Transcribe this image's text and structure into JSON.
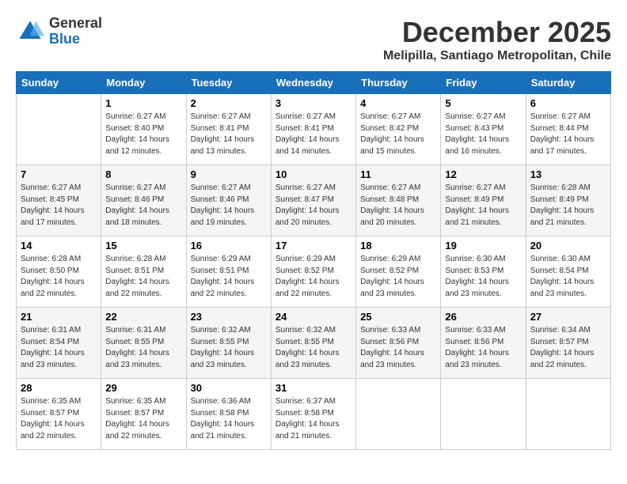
{
  "logo": {
    "line1": "General",
    "line2": "Blue"
  },
  "title": "December 2025",
  "location": "Melipilla, Santiago Metropolitan, Chile",
  "weekdays": [
    "Sunday",
    "Monday",
    "Tuesday",
    "Wednesday",
    "Thursday",
    "Friday",
    "Saturday"
  ],
  "weeks": [
    [
      {
        "day": "",
        "info": ""
      },
      {
        "day": "1",
        "info": "Sunrise: 6:27 AM\nSunset: 8:40 PM\nDaylight: 14 hours\nand 12 minutes."
      },
      {
        "day": "2",
        "info": "Sunrise: 6:27 AM\nSunset: 8:41 PM\nDaylight: 14 hours\nand 13 minutes."
      },
      {
        "day": "3",
        "info": "Sunrise: 6:27 AM\nSunset: 8:41 PM\nDaylight: 14 hours\nand 14 minutes."
      },
      {
        "day": "4",
        "info": "Sunrise: 6:27 AM\nSunset: 8:42 PM\nDaylight: 14 hours\nand 15 minutes."
      },
      {
        "day": "5",
        "info": "Sunrise: 6:27 AM\nSunset: 8:43 PM\nDaylight: 14 hours\nand 16 minutes."
      },
      {
        "day": "6",
        "info": "Sunrise: 6:27 AM\nSunset: 8:44 PM\nDaylight: 14 hours\nand 17 minutes."
      }
    ],
    [
      {
        "day": "7",
        "info": "Sunrise: 6:27 AM\nSunset: 8:45 PM\nDaylight: 14 hours\nand 17 minutes."
      },
      {
        "day": "8",
        "info": "Sunrise: 6:27 AM\nSunset: 8:46 PM\nDaylight: 14 hours\nand 18 minutes."
      },
      {
        "day": "9",
        "info": "Sunrise: 6:27 AM\nSunset: 8:46 PM\nDaylight: 14 hours\nand 19 minutes."
      },
      {
        "day": "10",
        "info": "Sunrise: 6:27 AM\nSunset: 8:47 PM\nDaylight: 14 hours\nand 20 minutes."
      },
      {
        "day": "11",
        "info": "Sunrise: 6:27 AM\nSunset: 8:48 PM\nDaylight: 14 hours\nand 20 minutes."
      },
      {
        "day": "12",
        "info": "Sunrise: 6:27 AM\nSunset: 8:49 PM\nDaylight: 14 hours\nand 21 minutes."
      },
      {
        "day": "13",
        "info": "Sunrise: 6:28 AM\nSunset: 8:49 PM\nDaylight: 14 hours\nand 21 minutes."
      }
    ],
    [
      {
        "day": "14",
        "info": "Sunrise: 6:28 AM\nSunset: 8:50 PM\nDaylight: 14 hours\nand 22 minutes."
      },
      {
        "day": "15",
        "info": "Sunrise: 6:28 AM\nSunset: 8:51 PM\nDaylight: 14 hours\nand 22 minutes."
      },
      {
        "day": "16",
        "info": "Sunrise: 6:29 AM\nSunset: 8:51 PM\nDaylight: 14 hours\nand 22 minutes."
      },
      {
        "day": "17",
        "info": "Sunrise: 6:29 AM\nSunset: 8:52 PM\nDaylight: 14 hours\nand 22 minutes."
      },
      {
        "day": "18",
        "info": "Sunrise: 6:29 AM\nSunset: 8:52 PM\nDaylight: 14 hours\nand 23 minutes."
      },
      {
        "day": "19",
        "info": "Sunrise: 6:30 AM\nSunset: 8:53 PM\nDaylight: 14 hours\nand 23 minutes."
      },
      {
        "day": "20",
        "info": "Sunrise: 6:30 AM\nSunset: 8:54 PM\nDaylight: 14 hours\nand 23 minutes."
      }
    ],
    [
      {
        "day": "21",
        "info": "Sunrise: 6:31 AM\nSunset: 8:54 PM\nDaylight: 14 hours\nand 23 minutes."
      },
      {
        "day": "22",
        "info": "Sunrise: 6:31 AM\nSunset: 8:55 PM\nDaylight: 14 hours\nand 23 minutes."
      },
      {
        "day": "23",
        "info": "Sunrise: 6:32 AM\nSunset: 8:55 PM\nDaylight: 14 hours\nand 23 minutes."
      },
      {
        "day": "24",
        "info": "Sunrise: 6:32 AM\nSunset: 8:55 PM\nDaylight: 14 hours\nand 23 minutes."
      },
      {
        "day": "25",
        "info": "Sunrise: 6:33 AM\nSunset: 8:56 PM\nDaylight: 14 hours\nand 23 minutes."
      },
      {
        "day": "26",
        "info": "Sunrise: 6:33 AM\nSunset: 8:56 PM\nDaylight: 14 hours\nand 23 minutes."
      },
      {
        "day": "27",
        "info": "Sunrise: 6:34 AM\nSunset: 8:57 PM\nDaylight: 14 hours\nand 22 minutes."
      }
    ],
    [
      {
        "day": "28",
        "info": "Sunrise: 6:35 AM\nSunset: 8:57 PM\nDaylight: 14 hours\nand 22 minutes."
      },
      {
        "day": "29",
        "info": "Sunrise: 6:35 AM\nSunset: 8:57 PM\nDaylight: 14 hours\nand 22 minutes."
      },
      {
        "day": "30",
        "info": "Sunrise: 6:36 AM\nSunset: 8:58 PM\nDaylight: 14 hours\nand 21 minutes."
      },
      {
        "day": "31",
        "info": "Sunrise: 6:37 AM\nSunset: 8:58 PM\nDaylight: 14 hours\nand 21 minutes."
      },
      {
        "day": "",
        "info": ""
      },
      {
        "day": "",
        "info": ""
      },
      {
        "day": "",
        "info": ""
      }
    ]
  ]
}
